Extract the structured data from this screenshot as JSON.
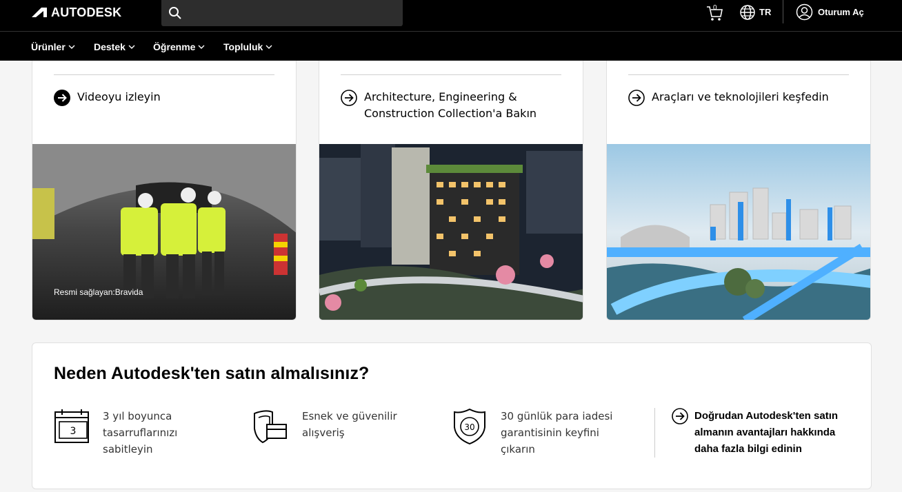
{
  "header": {
    "logo_text": "AUTODESK",
    "cart_count": "0",
    "language": "TR",
    "signin_label": "Oturum Aç"
  },
  "nav": {
    "items": [
      {
        "label": "Ürünler"
      },
      {
        "label": "Destek"
      },
      {
        "label": "Öğrenme"
      },
      {
        "label": "Topluluk"
      }
    ]
  },
  "cards": [
    {
      "link": "Videoyu izleyin",
      "credit": "Resmi sağlayan:Bravida"
    },
    {
      "link": "Architecture, Engineering & Construction Collection'a Bakın"
    },
    {
      "link": "Araçları ve teknolojileri keşfedin"
    }
  ],
  "why": {
    "title": "Neden Autodesk'ten satın almalısınız?",
    "calendar_number": "3",
    "shield_number": "30",
    "features": [
      {
        "text": "3 yıl boyunca tasarruflarınızı sabitleyin"
      },
      {
        "text": "Esnek ve güvenilir alışveriş"
      },
      {
        "text": "30 günlük para iadesi garantisinin keyfini çıkarın"
      }
    ],
    "link": "Doğrudan Autodesk'ten satın almanın avantajları hakkında daha fazla bilgi edinin"
  },
  "colors": {
    "header_bg": "#000000",
    "search_bg": "#2d2d2d",
    "page_bg": "#f5f5f5",
    "card_bg": "#ffffff"
  }
}
